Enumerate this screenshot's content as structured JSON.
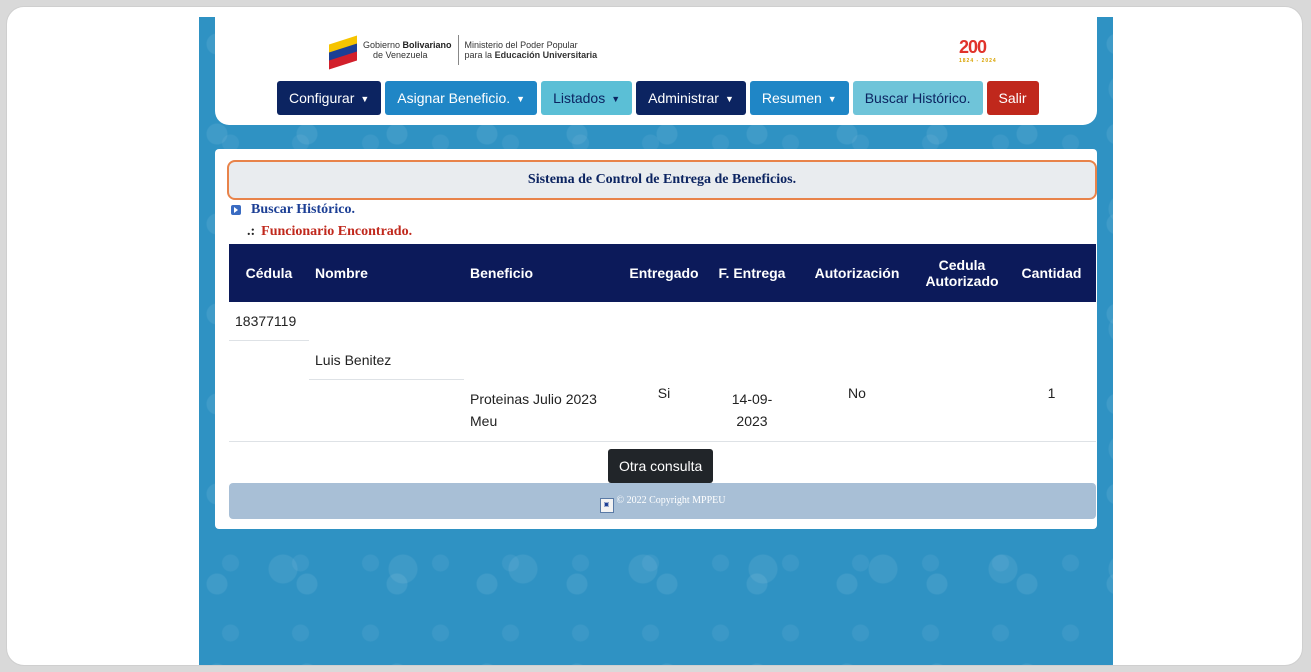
{
  "header": {
    "gov_line1_prefix": "Gobierno ",
    "gov_line1_bold": "Bolivariano",
    "gov_line2": "de Venezuela",
    "ministry_line1": "Ministerio del Poder Popular",
    "ministry_line2_prefix": "para la ",
    "ministry_line2_bold": "Educación Universitaria",
    "logo_right_text": "200",
    "logo_right_sub": "1824 - 2024"
  },
  "nav": {
    "configurar": "Configurar",
    "asignar": "Asignar Beneficio.",
    "listados": "Listados",
    "administrar": "Administrar",
    "resumen": "Resumen",
    "buscar_historico": "Buscar Histórico.",
    "salir": "Salir"
  },
  "main": {
    "title": "Sistema de Control de Entrega de Beneficios.",
    "crumb_search": "Buscar Histórico.",
    "crumb_found_prefix": ".:",
    "crumb_found": "Funcionario Encontrado."
  },
  "table": {
    "headers": [
      "Cédula",
      "Nombre",
      "Beneficio",
      "Entregado",
      "F. Entrega",
      "Autorización",
      "Cedula Autorizado",
      "Cantidad"
    ],
    "cedula": "18377119",
    "nombre": "Luis Benitez",
    "beneficio": "Proteinas Julio 2023 Meu",
    "entregado": "Si",
    "fecha_line1": "14-09-",
    "fecha_line2": "2023",
    "autorizacion": "No",
    "cedula_autorizado": "",
    "cantidad": "1"
  },
  "actions": {
    "otra_consulta": "Otra consulta"
  },
  "footer": {
    "copyright": "© 2022 Copyright MPPEU"
  }
}
